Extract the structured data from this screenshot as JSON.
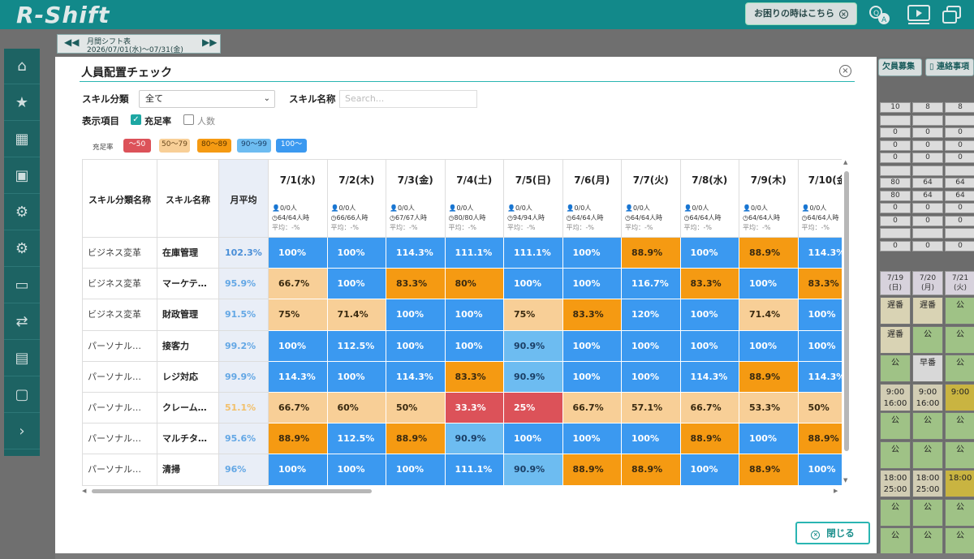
{
  "app": {
    "logo": "R-Shift",
    "help_label": "お困りの時はこちら",
    "help_icon": "x-circle-icon"
  },
  "shift_nav": {
    "title": "月間シフト表",
    "range": "2026/07/01(水)〜07/31(金)"
  },
  "bg_buttons": {
    "recruit": "欠員募集",
    "notice": "連絡事項"
  },
  "bg_right": {
    "num_rows": [
      [
        "10",
        "8",
        "8"
      ],
      [
        "",
        "",
        ""
      ],
      [
        "0",
        "0",
        "0"
      ],
      [
        "0",
        "0",
        "0"
      ],
      [
        "0",
        "0",
        "0"
      ],
      [
        "",
        "",
        ""
      ],
      [
        "80",
        "64",
        "64"
      ],
      [
        "80",
        "64",
        "64"
      ],
      [
        "0",
        "0",
        "0"
      ],
      [
        "0",
        "0",
        "0"
      ],
      [
        "",
        "",
        ""
      ],
      [
        "0",
        "0",
        "0"
      ]
    ],
    "dates": [
      [
        "7/19",
        "(日)"
      ],
      [
        "7/20",
        "(月)"
      ],
      [
        "7/21",
        "(火)"
      ]
    ],
    "shifts": [
      [
        "遅番",
        "遅番",
        "公"
      ],
      [
        "遅番",
        "公",
        "公"
      ],
      [
        "公",
        "早番",
        "公"
      ],
      [
        "9:00 16:00",
        "9:00 16:00",
        "9:00"
      ],
      [
        "公",
        "公",
        "公"
      ],
      [
        "公",
        "公",
        "公"
      ],
      [
        "18:00 25:00",
        "18:00 25:00",
        "18:00"
      ],
      [
        "公",
        "公",
        "公"
      ],
      [
        "公",
        "公",
        "公"
      ]
    ]
  },
  "modal": {
    "title": "人員配置チェック",
    "filter": {
      "skill_category_label": "スキル分類",
      "skill_category_value": "全て",
      "skill_name_label": "スキル名称",
      "skill_name_placeholder": "Search..."
    },
    "display": {
      "label": "表示項目",
      "rate_label": "充足率",
      "rate_checked": true,
      "count_label": "人数",
      "count_checked": false
    },
    "legend": {
      "label": "充足率",
      "items": [
        {
          "label": "〜50",
          "color": "#dc5259",
          "text_color": "#ffffff"
        },
        {
          "label": "50〜79",
          "color": "#f8cf97",
          "text_color": "#6b4a1e"
        },
        {
          "label": "80〜89",
          "color": "#f59a12",
          "text_color": "#5a3500"
        },
        {
          "label": "90〜99",
          "color": "#6dbcf1",
          "text_color": "#1b3f66"
        },
        {
          "label": "100〜",
          "color": "#3b99f0",
          "text_color": "#ffffff"
        }
      ]
    },
    "table": {
      "headers": {
        "category": "スキル分類名称",
        "skill": "スキル名称",
        "avg": "月平均"
      },
      "dates": [
        {
          "label": "7/1(水)",
          "people": "0/0人",
          "hours": "64/64人時",
          "avg": "平均：-%"
        },
        {
          "label": "7/2(木)",
          "people": "0/0人",
          "hours": "66/66人時",
          "avg": "平均：-%"
        },
        {
          "label": "7/3(金)",
          "people": "0/0人",
          "hours": "67/67人時",
          "avg": "平均：-%"
        },
        {
          "label": "7/4(土)",
          "people": "0/0人",
          "hours": "80/80人時",
          "avg": "平均：-%"
        },
        {
          "label": "7/5(日)",
          "people": "0/0人",
          "hours": "94/94人時",
          "avg": "平均：-%"
        },
        {
          "label": "7/6(月)",
          "people": "0/0人",
          "hours": "64/64人時",
          "avg": "平均：-%"
        },
        {
          "label": "7/7(火)",
          "people": "0/0人",
          "hours": "64/64人時",
          "avg": "平均：-%"
        },
        {
          "label": "7/8(水)",
          "people": "0/0人",
          "hours": "64/64人時",
          "avg": "平均：-%"
        },
        {
          "label": "7/9(木)",
          "people": "0/0人",
          "hours": "64/64人時",
          "avg": "平均：-%"
        },
        {
          "label": "7/10(金",
          "people": "0/0人",
          "hours": "64/64人時",
          "avg": "平均：-%"
        }
      ],
      "rows": [
        {
          "category": "ビジネス変革",
          "skill": "在庫管理",
          "avg": "102.3%",
          "avg_color": "#4a8fd8",
          "values": [
            "100%",
            "100%",
            "114.3%",
            "111.1%",
            "111.1%",
            "100%",
            "88.9%",
            "100%",
            "88.9%",
            "114.3%"
          ],
          "levels": [
            5,
            5,
            5,
            5,
            5,
            5,
            3,
            5,
            3,
            5
          ]
        },
        {
          "category": "ビジネス変革",
          "skill": "マーケテ…",
          "avg": "95.9%",
          "avg_color": "#63a7e5",
          "values": [
            "66.7%",
            "100%",
            "83.3%",
            "80%",
            "100%",
            "100%",
            "116.7%",
            "83.3%",
            "100%",
            "83.3%"
          ],
          "levels": [
            2,
            5,
            3,
            3,
            5,
            5,
            5,
            3,
            5,
            3
          ]
        },
        {
          "category": "ビジネス変革",
          "skill": "財政管理",
          "avg": "91.5%",
          "avg_color": "#63a7e5",
          "values": [
            "75%",
            "71.4%",
            "100%",
            "100%",
            "75%",
            "83.3%",
            "120%",
            "100%",
            "71.4%",
            "100%"
          ],
          "levels": [
            2,
            2,
            5,
            5,
            2,
            3,
            5,
            5,
            2,
            5
          ]
        },
        {
          "category": "パーソナル…",
          "skill": "接客力",
          "avg": "99.2%",
          "avg_color": "#63a7e5",
          "values": [
            "100%",
            "112.5%",
            "100%",
            "100%",
            "90.9%",
            "100%",
            "100%",
            "100%",
            "100%",
            "100%"
          ],
          "levels": [
            5,
            5,
            5,
            5,
            4,
            5,
            5,
            5,
            5,
            5
          ]
        },
        {
          "category": "パーソナル…",
          "skill": "レジ対応",
          "avg": "99.9%",
          "avg_color": "#63a7e5",
          "values": [
            "114.3%",
            "100%",
            "114.3%",
            "83.3%",
            "90.9%",
            "100%",
            "100%",
            "114.3%",
            "88.9%",
            "114.3%"
          ],
          "levels": [
            5,
            5,
            5,
            3,
            4,
            5,
            5,
            5,
            3,
            5
          ]
        },
        {
          "category": "パーソナル…",
          "skill": "クレーム…",
          "avg": "51.1%",
          "avg_color": "#f2c06b",
          "values": [
            "66.7%",
            "60%",
            "50%",
            "33.3%",
            "25%",
            "66.7%",
            "57.1%",
            "66.7%",
            "53.3%",
            "50%"
          ],
          "levels": [
            2,
            2,
            2,
            1,
            1,
            2,
            2,
            2,
            2,
            2
          ]
        },
        {
          "category": "パーソナル…",
          "skill": "マルチタ…",
          "avg": "95.6%",
          "avg_color": "#63a7e5",
          "values": [
            "88.9%",
            "112.5%",
            "88.9%",
            "90.9%",
            "100%",
            "100%",
            "100%",
            "88.9%",
            "100%",
            "88.9%"
          ],
          "levels": [
            3,
            5,
            3,
            4,
            5,
            5,
            5,
            3,
            5,
            3
          ]
        },
        {
          "category": "パーソナル…",
          "skill": "清掃",
          "avg": "96%",
          "avg_color": "#63a7e5",
          "values": [
            "100%",
            "100%",
            "100%",
            "111.1%",
            "90.9%",
            "88.9%",
            "88.9%",
            "100%",
            "88.9%",
            "100%"
          ],
          "levels": [
            5,
            5,
            5,
            5,
            4,
            3,
            3,
            5,
            3,
            5
          ]
        }
      ]
    },
    "close_label": "閉じる"
  }
}
